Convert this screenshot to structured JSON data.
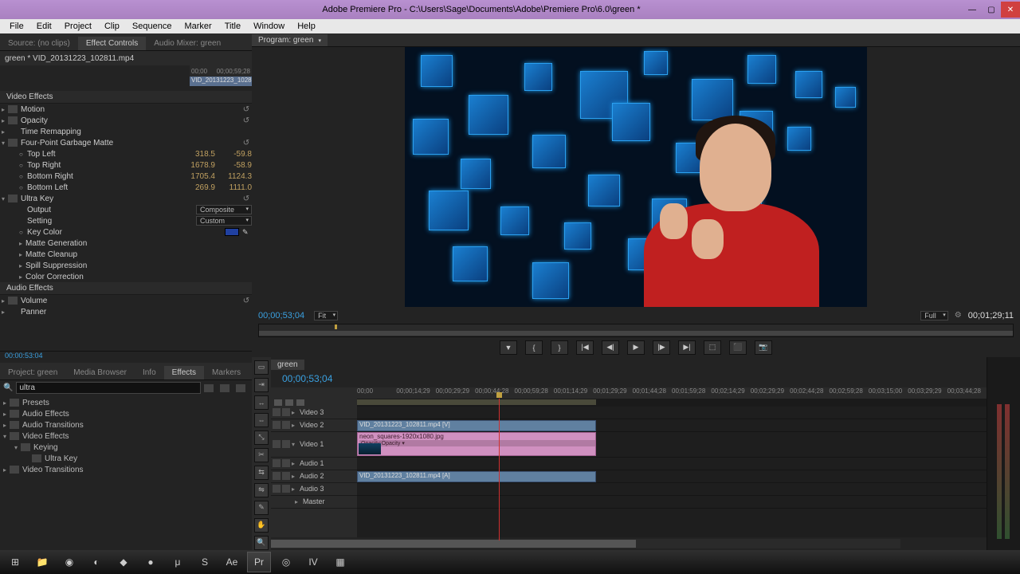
{
  "title": "Adobe Premiere Pro - C:\\Users\\Sage\\Documents\\Adobe\\Premiere Pro\\6.0\\green *",
  "menu": [
    "File",
    "Edit",
    "Project",
    "Clip",
    "Sequence",
    "Marker",
    "Title",
    "Window",
    "Help"
  ],
  "ec_tabs": [
    "Source: (no clips)",
    "Effect Controls",
    "Audio Mixer: green"
  ],
  "ec_active_tab": "Effect Controls",
  "ec_clip": "green * VID_20131223_102811.mp4",
  "ec_mini_l": "00;00",
  "ec_mini_r": "00;00;59;28",
  "ec_mini_tag": "VID_20131223_1028",
  "video_effects_label": "Video Effects",
  "fx": {
    "motion": "Motion",
    "opacity": "Opacity",
    "time": "Time Remapping",
    "matte": "Four-Point Garbage Matte",
    "ultra": "Ultra Key"
  },
  "matte": {
    "tl_label": "Top Left",
    "tl_x": "318.5",
    "tl_y": "-59.8",
    "tr_label": "Top Right",
    "tr_x": "1678.9",
    "tr_y": "-58.9",
    "br_label": "Bottom Right",
    "br_x": "1705.4",
    "br_y": "1124.3",
    "bl_label": "Bottom Left",
    "bl_x": "269.9",
    "bl_y": "1111.0"
  },
  "ultra": {
    "output_label": "Output",
    "output_val": "Composite",
    "setting_label": "Setting",
    "setting_val": "Custom",
    "key_label": "Key Color",
    "mg": "Matte Generation",
    "mc": "Matte Cleanup",
    "ss": "Spill Suppression",
    "cc": "Color Correction"
  },
  "audio_effects_label": "Audio Effects",
  "afx": {
    "volume": "Volume",
    "panner": "Panner"
  },
  "ll_tc": "00:00:53:04",
  "ll_tabs": [
    "Project: green",
    "Media Browser",
    "Info",
    "Effects",
    "Markers"
  ],
  "ll_active": "Effects",
  "ll_search": "ultra",
  "ll_tree": {
    "presets": "Presets",
    "ae": "Audio Effects",
    "at": "Audio Transitions",
    "ve": "Video Effects",
    "keying": "Keying",
    "uk": "Ultra Key",
    "vt": "Video Transitions"
  },
  "prog_tab": "Program: green",
  "prog_tc_l": "00;00;53;04",
  "prog_fit": "Fit",
  "prog_full": "Full",
  "prog_tc_r": "00;01;29;11",
  "tl_tab": "green",
  "tl_tc": "00;00;53;04",
  "tl_ticks": [
    "00;00",
    "00;00;14;29",
    "00;00;29;29",
    "00;00;44;28",
    "00;00;59;28",
    "00;01;14;29",
    "00;01;29;29",
    "00;01;44;28",
    "00;01;59;28",
    "00;02;14;29",
    "00;02;29;29",
    "00;02;44;28",
    "00;02;59;28",
    "00;03;15;00",
    "00;03;29;29",
    "00;03;44;28"
  ],
  "tracks": {
    "v3": "Video 3",
    "v2": "Video 2",
    "v1": "Video 1",
    "a1": "Audio 1",
    "a2": "Audio 2",
    "a3": "Audio 3",
    "master": "Master"
  },
  "clips": {
    "v2": "VID_20131223_102811.mp4 [V]",
    "v1": "neon_squares-1920x1080.jpg",
    "v1_opac": "Opacity:Opacity ▾",
    "a2": "VID_20131223_102811.mp4 [A]"
  }
}
